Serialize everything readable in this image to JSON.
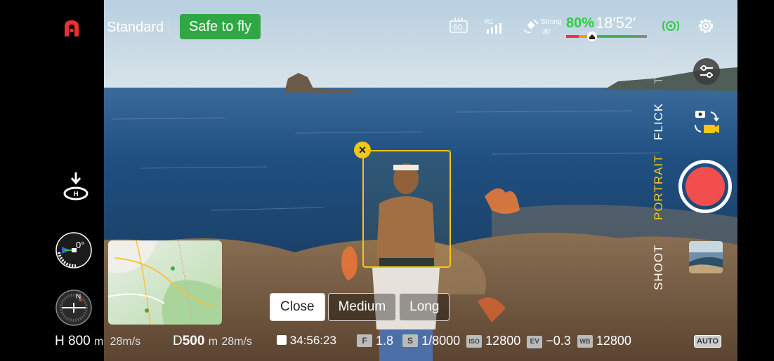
{
  "topbar": {
    "flight_mode": "Standard",
    "status": "Safe to fly",
    "video_tx_label": "60",
    "rc_label": "RC",
    "gps_strength": "Strong",
    "gps_satellites": "30",
    "battery_percent": "80%",
    "flight_time": "18′52′",
    "battery_level": 0.8
  },
  "shooting_modes": {
    "track": "TRAC",
    "flick": "FLICK",
    "portrait": "PORTRAIT",
    "shoot": "SHOOT",
    "active": "PORTRAIT"
  },
  "compass": {
    "heading": "0°",
    "north": "N"
  },
  "framing": {
    "options": [
      "Close",
      "Medium",
      "Long"
    ],
    "selected": "Close"
  },
  "telemetry": {
    "height_label": "H",
    "height_value": "800",
    "height_unit": "m",
    "vspeed": "28m/s",
    "distance_label": "D",
    "distance_value": "500",
    "distance_unit": "m",
    "hspeed": "28m/s",
    "record_time": "34:56:23",
    "f_badge": "F",
    "aperture": "1.8",
    "s_badge": "S",
    "shutter": "1/8000",
    "iso_badge": "ISO",
    "iso": "12800",
    "ev_badge": "EV",
    "ev": "−0.3",
    "wb_badge": "WB",
    "wb": "12800",
    "auto_badge": "AUTO"
  },
  "colors": {
    "accent_yellow": "#f5c518",
    "safe_green": "#2fa844",
    "record_red": "#f24e4e",
    "battery_green": "#2ecc40"
  }
}
